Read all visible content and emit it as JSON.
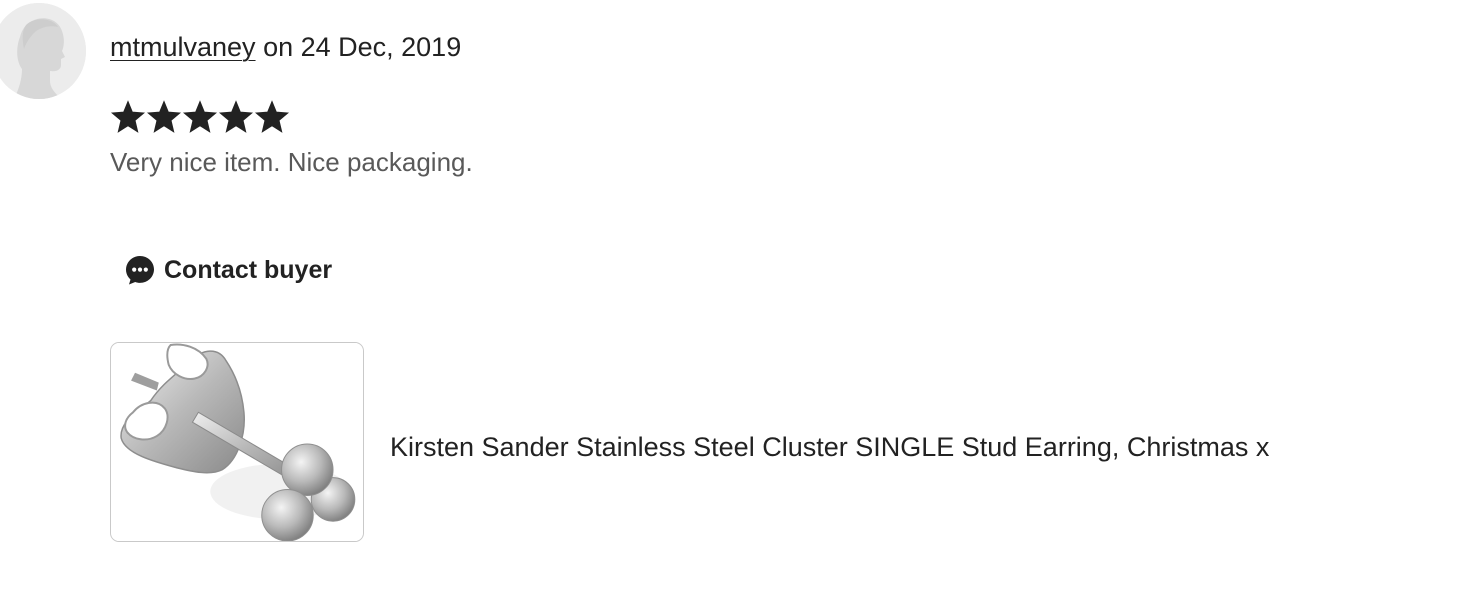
{
  "review": {
    "reviewer_name": "mtmulvaney",
    "date_text": "on 24 Dec, 2019",
    "rating": 5,
    "rating_max": 5,
    "text": "Very nice item. Nice packaging."
  },
  "actions": {
    "contact_label": "Contact buyer",
    "contact_icon": "chat-bubble-icon"
  },
  "product": {
    "title": "Kirsten Sander Stainless Steel Cluster SINGLE Stud Earring, Christmas x",
    "image_alt": "stainless steel cluster stud earring"
  },
  "colors": {
    "text_primary": "#222222",
    "text_secondary": "#595959",
    "star": "#222222",
    "thumb_border": "#c9c9c9"
  }
}
